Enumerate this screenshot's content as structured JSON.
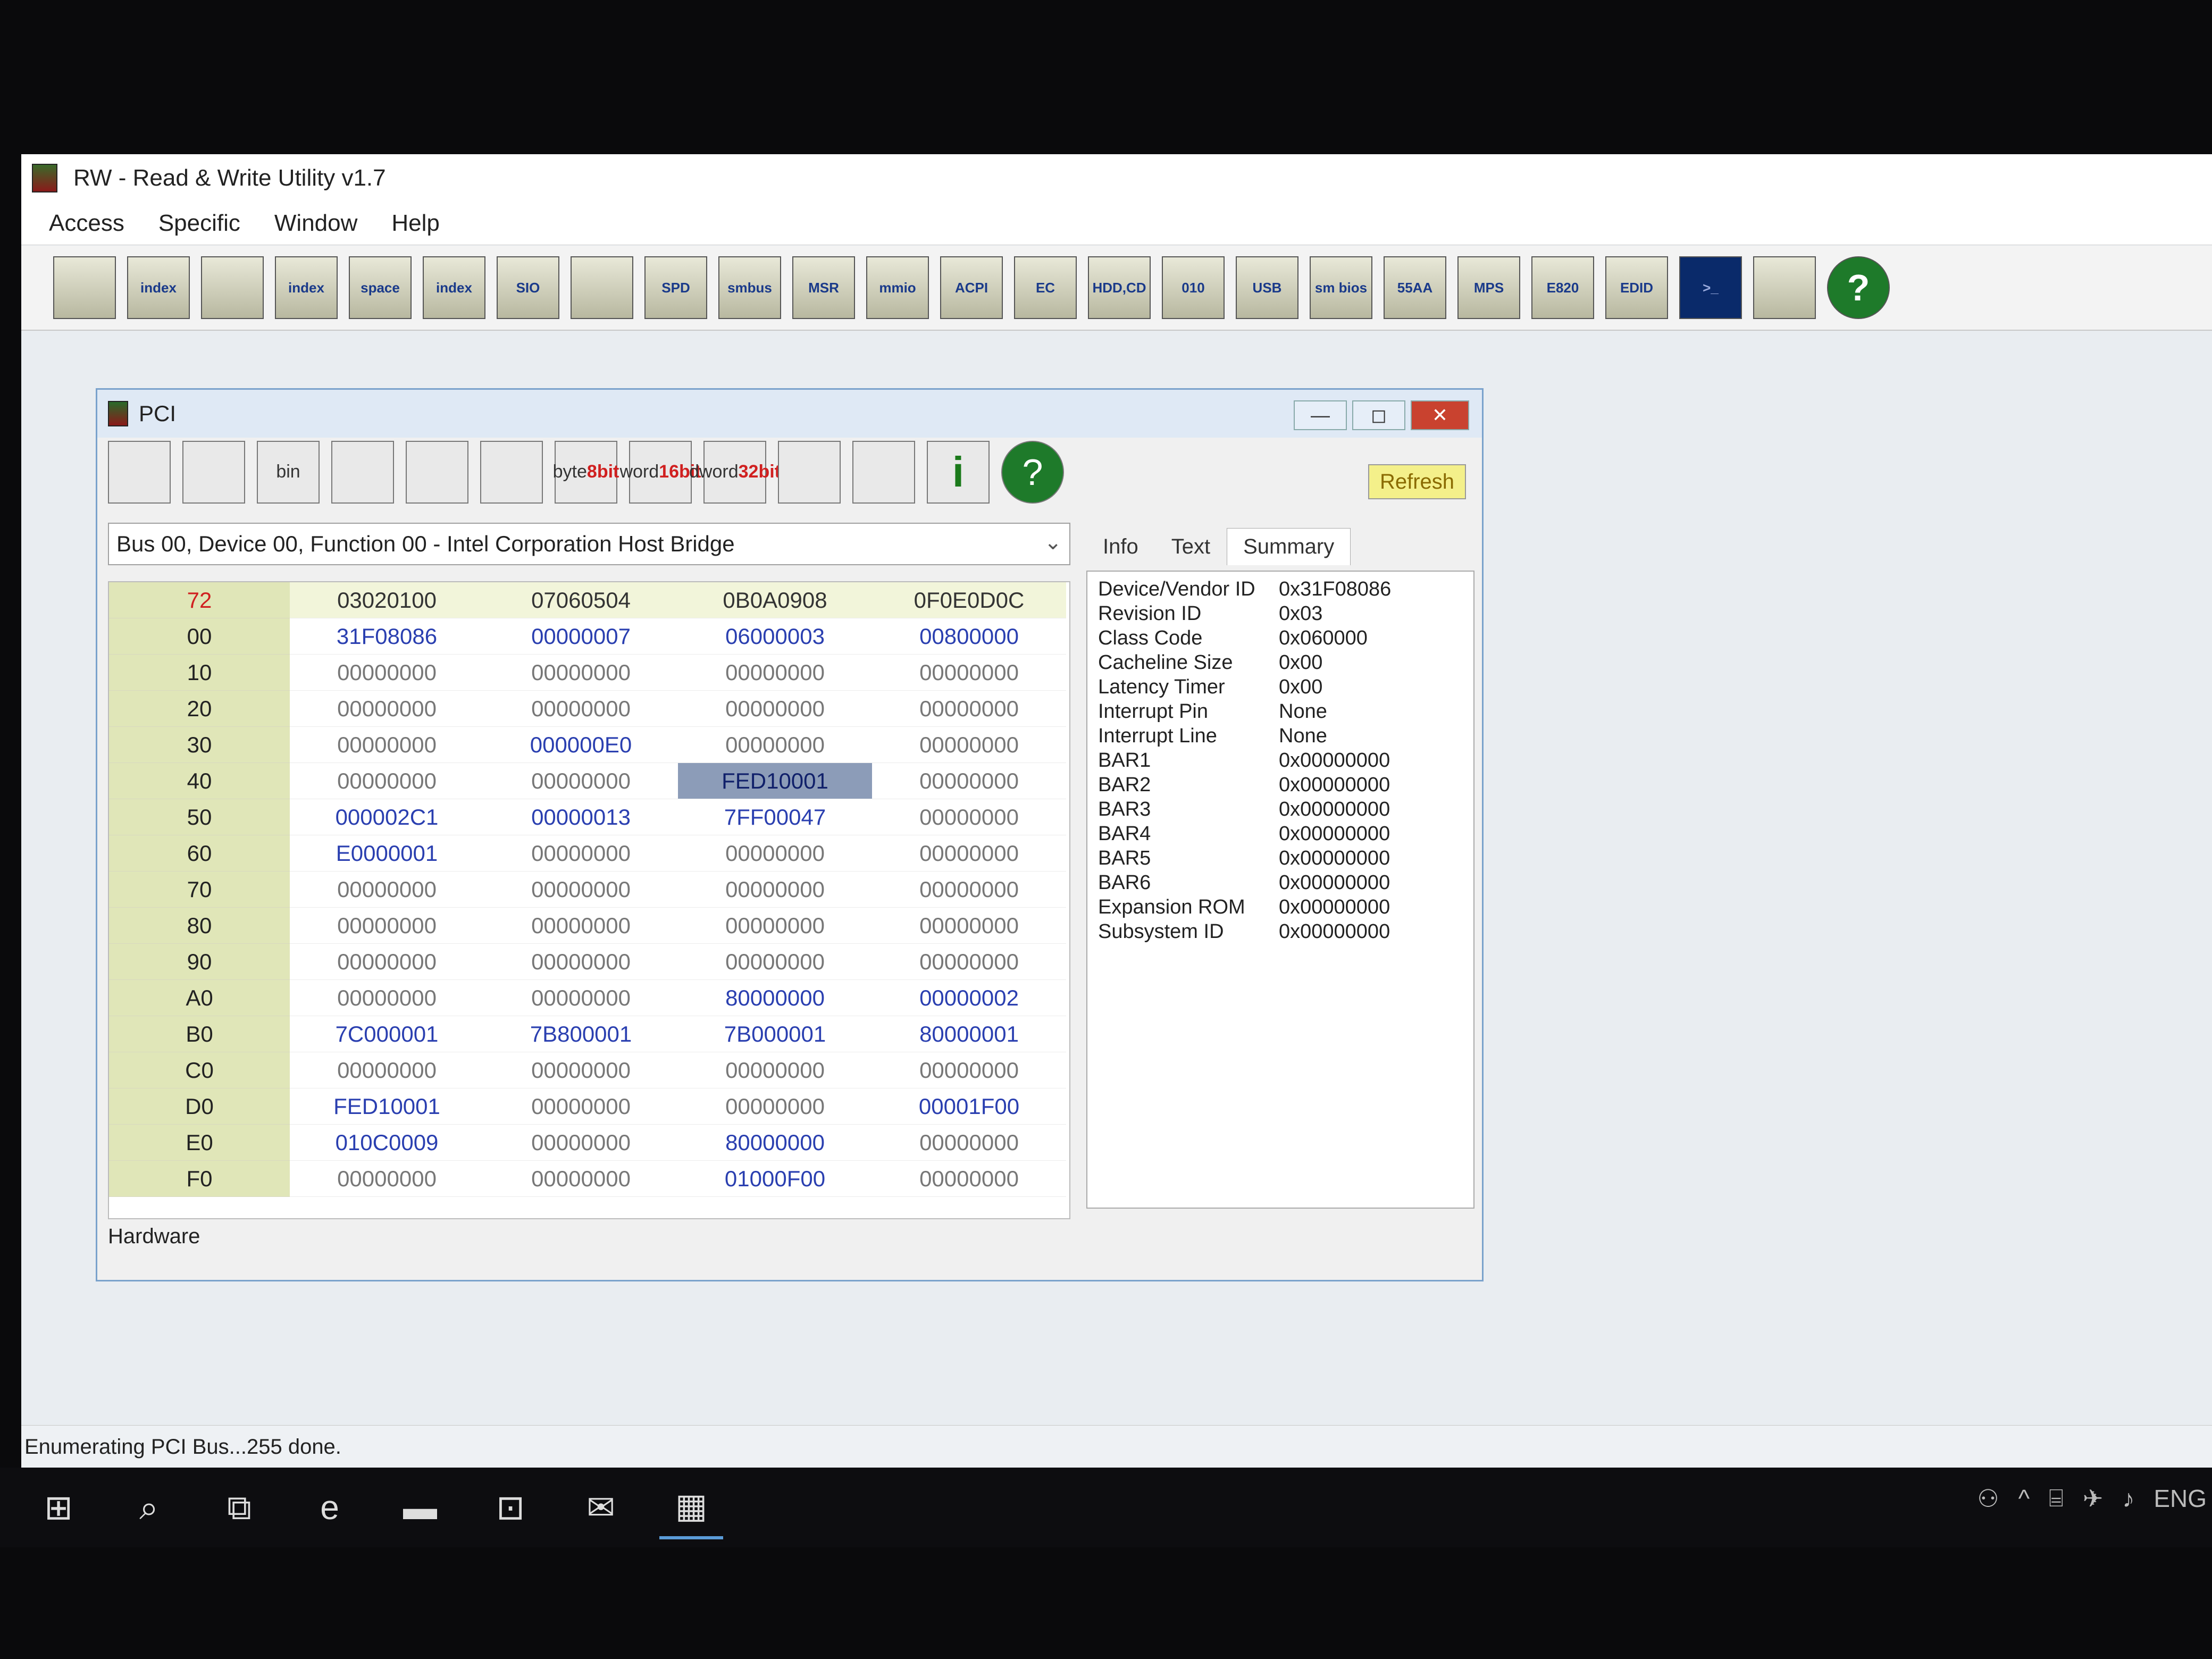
{
  "app": {
    "title": "RW - Read & Write Utility v1.7"
  },
  "menu": [
    "Access",
    "Specific",
    "Window",
    "Help"
  ],
  "main_toolbar": [
    {
      "label": "",
      "icon": "pci-card-icon"
    },
    {
      "label": "index",
      "icon": "index-pci-icon"
    },
    {
      "label": "",
      "icon": "memory-icon"
    },
    {
      "label": "index",
      "icon": "index-memory-icon"
    },
    {
      "label": "space",
      "icon": "io-space-icon"
    },
    {
      "label": "index",
      "icon": "io-index-icon"
    },
    {
      "label": "SIO",
      "icon": "sio-icon"
    },
    {
      "label": "",
      "icon": "waveform-icon"
    },
    {
      "label": "SPD",
      "icon": "spd-icon"
    },
    {
      "label": "smbus",
      "icon": "smbus-icon"
    },
    {
      "label": "MSR",
      "icon": "msr-icon"
    },
    {
      "label": "mmio",
      "icon": "mmio-icon"
    },
    {
      "label": "ACPI",
      "icon": "acpi-icon"
    },
    {
      "label": "EC",
      "icon": "ec-icon"
    },
    {
      "label": "HDD,CD",
      "icon": "hdd-cd-icon"
    },
    {
      "label": "010",
      "icon": "binary-icon"
    },
    {
      "label": "USB",
      "icon": "usb-icon"
    },
    {
      "label": "sm bios",
      "icon": "smbios-icon"
    },
    {
      "label": "55AA",
      "icon": "55aa-icon"
    },
    {
      "label": "MPS",
      "icon": "mps-icon"
    },
    {
      "label": "E820",
      "icon": "e820-icon"
    },
    {
      "label": "EDID",
      "icon": "edid-icon"
    },
    {
      "label": ">_",
      "icon": "console-icon"
    },
    {
      "label": "",
      "icon": "hardware-icon"
    },
    {
      "label": "?",
      "icon": "help-icon"
    }
  ],
  "pci_window": {
    "title": "PCI",
    "controls": {
      "minimize": "—",
      "maximize": "◻",
      "close": "✕"
    },
    "toolbar": [
      {
        "label": "",
        "icon": "save-icon"
      },
      {
        "label": "",
        "icon": "save-all-icon"
      },
      {
        "label": "bin",
        "icon": "save-bin-icon"
      },
      {
        "label": "",
        "icon": "open-file-icon"
      },
      {
        "label": "",
        "icon": "binoculars-icon"
      },
      {
        "label": "",
        "icon": "window-icon"
      },
      {
        "label": "byte",
        "sub": "8bit",
        "icon": "byte-mode-icon"
      },
      {
        "label": "word",
        "sub": "16bit",
        "icon": "word-mode-icon"
      },
      {
        "label": "dword",
        "sub": "32bit",
        "icon": "dword-mode-icon"
      },
      {
        "label": "",
        "icon": "tree-icon"
      },
      {
        "label": "",
        "icon": "disc-icon"
      },
      {
        "label": "i",
        "icon": "info-icon"
      },
      {
        "label": "?",
        "icon": "help-icon"
      }
    ],
    "refresh_label": "Refresh",
    "device_select": "Bus 00, Device 00, Function 00 - Intel Corporation Host Bridge",
    "grid": {
      "corner": "72",
      "headers": [
        "03020100",
        "07060504",
        "0B0A0908",
        "0F0E0D0C"
      ],
      "rows": [
        {
          "offset": "00",
          "cells": [
            "31F08086",
            "00000007",
            "06000003",
            "00800000"
          ]
        },
        {
          "offset": "10",
          "cells": [
            "00000000",
            "00000000",
            "00000000",
            "00000000"
          ]
        },
        {
          "offset": "20",
          "cells": [
            "00000000",
            "00000000",
            "00000000",
            "00000000"
          ]
        },
        {
          "offset": "30",
          "cells": [
            "00000000",
            "000000E0",
            "00000000",
            "00000000"
          ]
        },
        {
          "offset": "40",
          "cells": [
            "00000000",
            "00000000",
            "FED10001",
            "00000000"
          ]
        },
        {
          "offset": "50",
          "cells": [
            "000002C1",
            "00000013",
            "7FF00047",
            "00000000"
          ]
        },
        {
          "offset": "60",
          "cells": [
            "E0000001",
            "00000000",
            "00000000",
            "00000000"
          ]
        },
        {
          "offset": "70",
          "cells": [
            "00000000",
            "00000000",
            "00000000",
            "00000000"
          ]
        },
        {
          "offset": "80",
          "cells": [
            "00000000",
            "00000000",
            "00000000",
            "00000000"
          ]
        },
        {
          "offset": "90",
          "cells": [
            "00000000",
            "00000000",
            "00000000",
            "00000000"
          ]
        },
        {
          "offset": "A0",
          "cells": [
            "00000000",
            "00000000",
            "80000000",
            "00000002"
          ]
        },
        {
          "offset": "B0",
          "cells": [
            "7C000001",
            "7B800001",
            "7B000001",
            "80000001"
          ]
        },
        {
          "offset": "C0",
          "cells": [
            "00000000",
            "00000000",
            "00000000",
            "00000000"
          ]
        },
        {
          "offset": "D0",
          "cells": [
            "FED10001",
            "00000000",
            "00000000",
            "00001F00"
          ]
        },
        {
          "offset": "E0",
          "cells": [
            "010C0009",
            "00000000",
            "80000000",
            "00000000"
          ]
        },
        {
          "offset": "F0",
          "cells": [
            "00000000",
            "00000000",
            "01000F00",
            "00000000"
          ]
        }
      ],
      "selected": {
        "row": "40",
        "col": 2
      }
    },
    "tabs": [
      "Info",
      "Text",
      "Summary"
    ],
    "active_tab": "Summary",
    "summary": [
      {
        "label": "Device/Vendor ID",
        "value": "0x31F08086"
      },
      {
        "label": "Revision ID",
        "value": "0x03"
      },
      {
        "label": "Class Code",
        "value": "0x060000"
      },
      {
        "label": "Cacheline Size",
        "value": "0x00"
      },
      {
        "label": "Latency Timer",
        "value": "0x00"
      },
      {
        "label": "Interrupt Pin",
        "value": "None"
      },
      {
        "label": "Interrupt Line",
        "value": "None"
      },
      {
        "label": "BAR1",
        "value": "0x00000000"
      },
      {
        "label": "BAR2",
        "value": "0x00000000"
      },
      {
        "label": "BAR3",
        "value": "0x00000000"
      },
      {
        "label": "BAR4",
        "value": "0x00000000"
      },
      {
        "label": "BAR5",
        "value": "0x00000000"
      },
      {
        "label": "BAR6",
        "value": "0x00000000"
      },
      {
        "label": "Expansion ROM",
        "value": "0x00000000"
      },
      {
        "label": "Subsystem ID",
        "value": "0x00000000"
      }
    ],
    "status": "Hardware"
  },
  "statusbar": {
    "text": "Enumerating PCI Bus...255 done."
  },
  "taskbar": {
    "items": [
      {
        "icon": "windows-start-icon",
        "glyph": "⊞"
      },
      {
        "icon": "search-icon",
        "glyph": "⌕"
      },
      {
        "icon": "task-view-icon",
        "glyph": "⧉"
      },
      {
        "icon": "edge-icon",
        "glyph": "e"
      },
      {
        "icon": "file-explorer-icon",
        "glyph": "▬"
      },
      {
        "icon": "store-icon",
        "glyph": "⊡"
      },
      {
        "icon": "mail-icon",
        "glyph": "✉"
      },
      {
        "icon": "rw-app-icon",
        "glyph": "▦"
      }
    ],
    "tray": [
      {
        "icon": "people-icon",
        "glyph": "⚇"
      },
      {
        "icon": "chevron-up-icon",
        "glyph": "^"
      },
      {
        "icon": "network-icon",
        "glyph": "⌸"
      },
      {
        "icon": "airplane-icon",
        "glyph": "✈"
      },
      {
        "icon": "volume-icon",
        "glyph": "♪"
      },
      {
        "icon": "language-indicator",
        "glyph": "ENG"
      }
    ]
  },
  "colors": {
    "nonzero_value": "#2a3fb0",
    "zero_value": "#777777",
    "row_header_bg": "#e0e6b8",
    "selected_cell": "#8c9cb8",
    "refresh_bg": "#f4f08a"
  }
}
